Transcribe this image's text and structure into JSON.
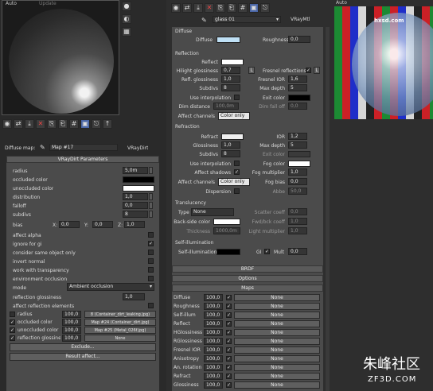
{
  "colors": {
    "bg": "#1e1e1e",
    "panel": "#4b4b4b",
    "diffuse_swatch": "#bfe0f5",
    "white": "#ffffff",
    "black": "#000000"
  },
  "left_editor": {
    "tabs": [
      "Auto",
      "Update"
    ],
    "diffuse_map_label": "Diffuse map:",
    "map_name": "Map #17",
    "map_type": "VRayDirt",
    "params_title": "VRayDirt Parameters",
    "params": [
      {
        "label": "radius",
        "value": "5,0m"
      },
      {
        "label": "occluded color",
        "value": ""
      },
      {
        "label": "unoccluded color",
        "value": ""
      },
      {
        "label": "distribution",
        "value": "1,0"
      },
      {
        "label": "falloff",
        "value": "0,0"
      },
      {
        "label": "subdivs",
        "value": "8"
      }
    ],
    "bias_label": "bias",
    "bias": {
      "x": "0,0",
      "y": "0,0",
      "z": "1,0"
    },
    "checks": [
      {
        "label": "affect alpha",
        "checked": false
      },
      {
        "label": "ignore for gi",
        "checked": true
      },
      {
        "label": "consider same object only",
        "checked": false
      },
      {
        "label": "invert normal",
        "checked": false
      },
      {
        "label": "work with transparency",
        "checked": false
      },
      {
        "label": "environment occlusion",
        "checked": false
      }
    ],
    "mode_label": "mode",
    "mode_value": "Ambient occlusion",
    "reflection_glossiness_label": "reflection glossiness",
    "reflection_glossiness_value": "1,0",
    "affect_reflection_label": "affect reflection elements",
    "maps": [
      {
        "label": "radius",
        "value": "100,0",
        "checked": false,
        "map": "8 (Container_dirt_leaking.jpg)"
      },
      {
        "label": "occluded color",
        "value": "100,0",
        "checked": true,
        "map": "Map #24 (Container_dirt.jpg)"
      },
      {
        "label": "unoccluded color",
        "value": "100,0",
        "checked": true,
        "map": "Map #25 (Metal_026f.jpg)"
      },
      {
        "label": "reflection glossiness",
        "value": "100,0",
        "checked": true,
        "map": "None"
      }
    ],
    "exclude_label": "Exclude...",
    "result_affect_label": "Result affect..."
  },
  "mid_editor": {
    "material_name": "glass 01",
    "material_type": "VRayMtl",
    "diffuse": {
      "header": "Diffuse",
      "diffuse_label": "Diffuse",
      "roughness_label": "Roughness",
      "roughness_value": "0,0"
    },
    "reflection": {
      "header": "Reflection",
      "reflect_label": "Reflect",
      "hilight_label": "Hilight glossiness",
      "hilight_value": "0,7",
      "fresnel_label": "Fresnel reflections",
      "refl_gloss_label": "Refl. glossiness",
      "refl_gloss_value": "1,0",
      "fresnel_ior_label": "Fresnel IOR",
      "fresnel_ior_value": "1,6",
      "subdivs_label": "Subdivs",
      "subdivs_value": "8",
      "max_depth_label": "Max depth",
      "max_depth_value": "5",
      "use_interp_label": "Use interpolation",
      "exit_color_label": "Exit color",
      "dim_distance_label": "Dim distance",
      "dim_distance_value": "100,0m",
      "dim_falloff_label": "Dim fall off",
      "dim_falloff_value": "0,0",
      "affect_channels_label": "Affect channels",
      "affect_channels_value": "Color only"
    },
    "refraction": {
      "header": "Refraction",
      "refract_label": "Refract",
      "ior_label": "IOR",
      "ior_value": "1,2",
      "gloss_label": "Glossiness",
      "gloss_value": "1,0",
      "max_depth_label": "Max depth",
      "max_depth_value": "5",
      "subdivs_label": "Subdivs",
      "subdivs_value": "8",
      "exit_color_label": "Exit color",
      "use_interp_label": "Use interpolation",
      "fog_color_label": "Fog color",
      "affect_shadows_label": "Affect shadows",
      "fog_mult_label": "Fog multiplier",
      "fog_mult_value": "1,0",
      "affect_channels_label": "Affect channels",
      "affect_channels_value": "Color only",
      "fog_bias_label": "Fog bias",
      "fog_bias_value": "0,0",
      "dispersion_label": "Dispersion",
      "abbe_label": "Abbe",
      "abbe_value": "50,0"
    },
    "translucency": {
      "header": "Translucency",
      "type_label": "Type",
      "type_value": "None",
      "scatter_label": "Scatter coeff",
      "scatter_value": "0,0",
      "backside_label": "Back-side color",
      "fwd_bck_label": "Fwd/bck coeff",
      "fwd_bck_value": "1,0",
      "thickness_label": "Thickness",
      "thickness_value": "1000,0m",
      "light_mult_label": "Light multiplier",
      "light_mult_value": "1,0"
    },
    "selfillum": {
      "header": "Self-illumination",
      "label": "Self-illumination",
      "gi_label": "GI",
      "mult_label": "Mult",
      "mult_value": "0,0"
    },
    "rollouts": [
      "BRDF",
      "Options",
      "Maps"
    ],
    "maps": [
      {
        "label": "Diffuse",
        "value": "100,0",
        "map": "None"
      },
      {
        "label": "Roughness",
        "value": "100,0",
        "map": "None"
      },
      {
        "label": "Self-illum",
        "value": "100,0",
        "map": "None"
      },
      {
        "label": "Reflect",
        "value": "100,0",
        "map": "None"
      },
      {
        "label": "HGlossiness",
        "value": "100,0",
        "map": "None"
      },
      {
        "label": "RGlossiness",
        "value": "100,0",
        "map": "None"
      },
      {
        "label": "Fresnel IOR",
        "value": "100,0",
        "map": "None"
      },
      {
        "label": "Anisotropy",
        "value": "100,0",
        "map": "None"
      },
      {
        "label": "An. rotation",
        "value": "100,0",
        "map": "None"
      },
      {
        "label": "Refract",
        "value": "100,0",
        "map": "None"
      },
      {
        "label": "Glossiness",
        "value": "100,0",
        "map": "None"
      }
    ]
  },
  "right_preview": {
    "tab": "Auto",
    "watermark_top": "hxsd.com",
    "watermark_bottom_cn": "朱峰社区",
    "watermark_bottom_en": "ZF3D.COM"
  },
  "icons": [
    "sphere-icon",
    "assign-icon",
    "delete-icon",
    "copy-icon",
    "show-map-icon",
    "parent-icon",
    "eyedropper-icon"
  ]
}
